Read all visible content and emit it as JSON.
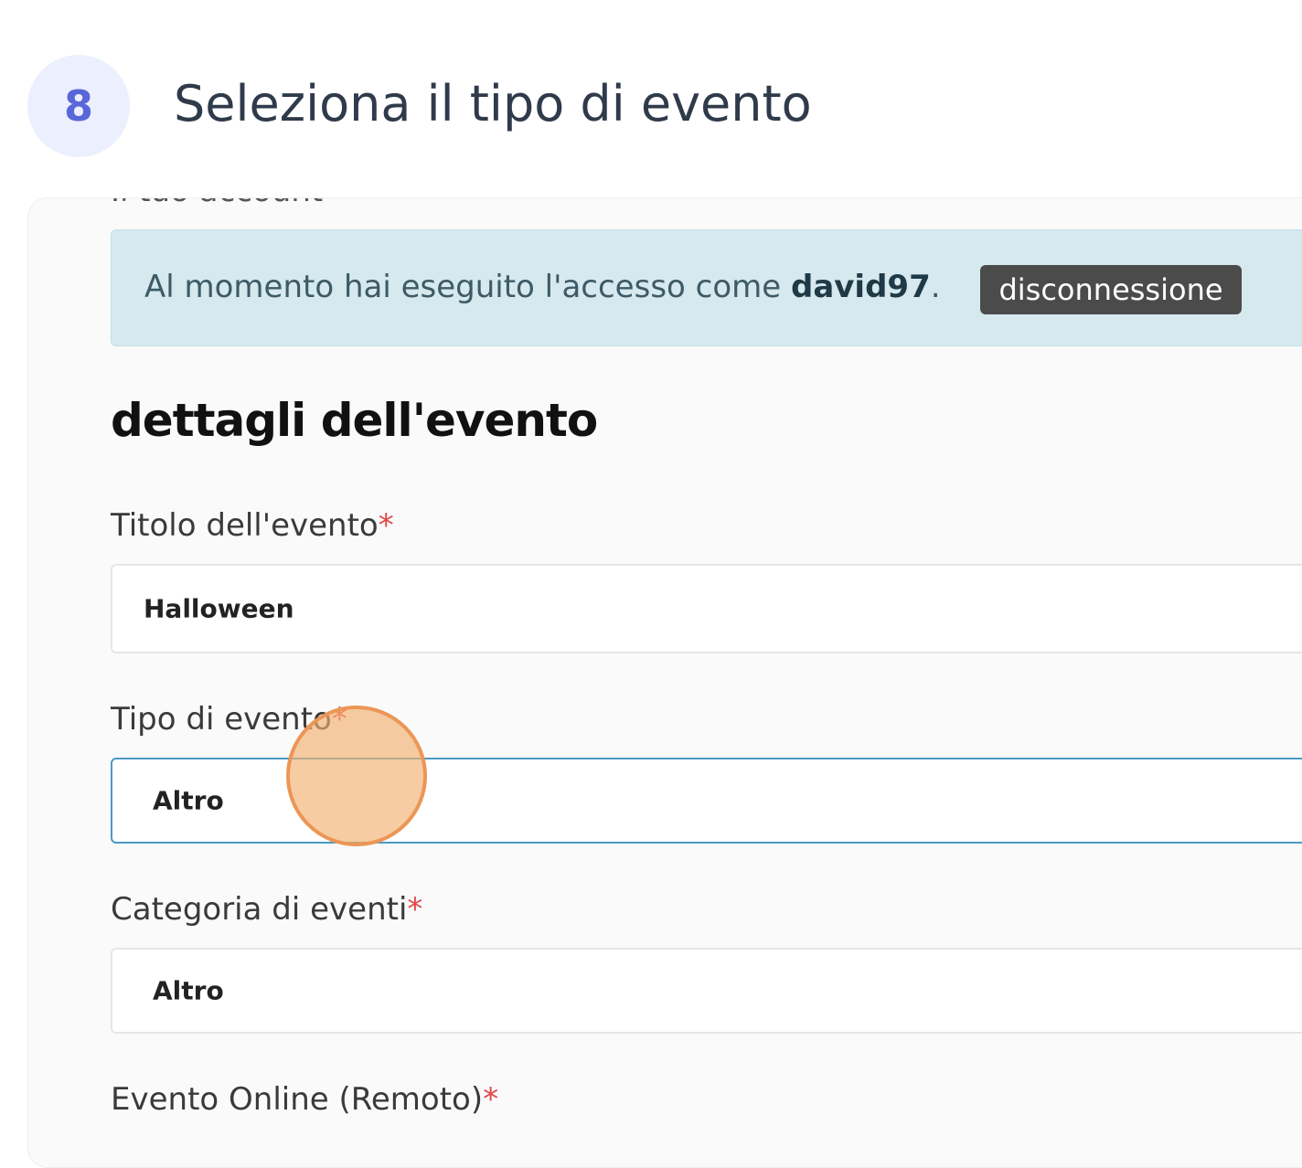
{
  "step": {
    "number": "8",
    "title": "Seleziona il tipo di evento"
  },
  "partial_heading": "Il tuo account",
  "alert": {
    "text_prefix": "Al momento hai eseguito l'accesso come ",
    "username": "david97",
    "text_suffix": ".",
    "logout_label": "disconnessione"
  },
  "section_title": "dettagli dell'evento",
  "fields": {
    "title": {
      "label": "Titolo dell'evento",
      "required_mark": "*",
      "value": "Halloween"
    },
    "type": {
      "label": "Tipo di evento",
      "required_mark": "*",
      "value": "Altro"
    },
    "category": {
      "label": "Categoria di eventi",
      "required_mark": "*",
      "value": "Altro"
    },
    "online": {
      "label": "Evento Online (Remoto)",
      "required_mark": "*"
    }
  },
  "colors": {
    "badge_bg": "#eceffd",
    "badge_fg": "#5a67d8",
    "alert_bg": "#d5e9ee",
    "required": "#e04848",
    "focus_border": "#4a9ac2",
    "click_marker": "#ec9656"
  }
}
